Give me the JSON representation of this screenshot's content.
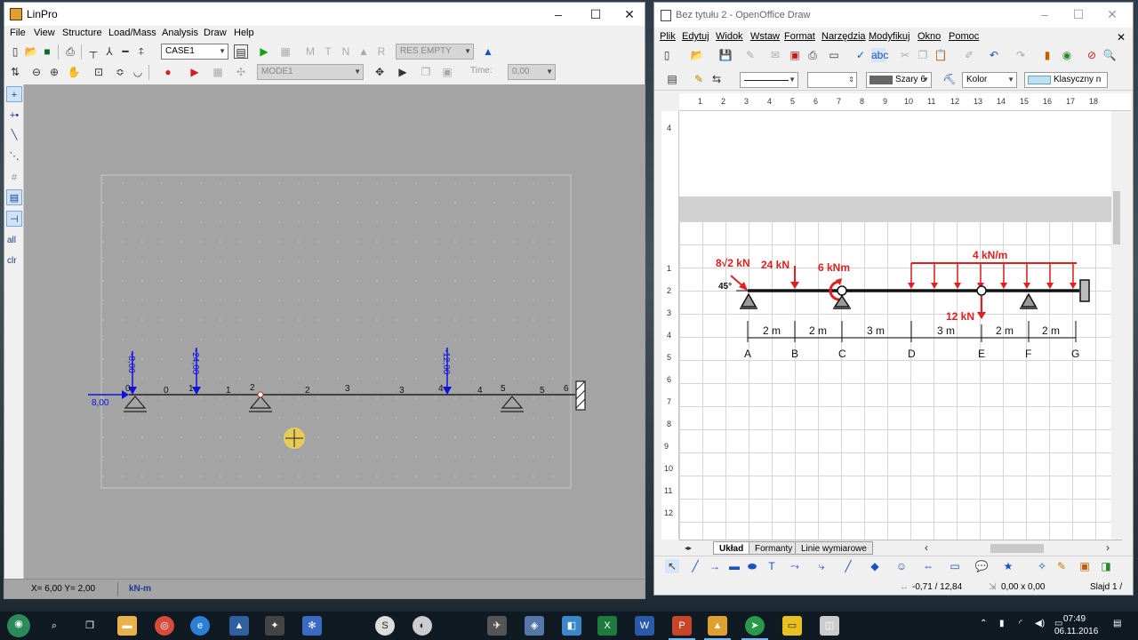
{
  "linpro": {
    "title": "LinPro",
    "menu": [
      "File",
      "View",
      "Structure",
      "Load/Mass",
      "Analysis",
      "Draw",
      "Help"
    ],
    "case_combo": "CASE1",
    "results_combo": "RES EMPTY",
    "mode_combo": "MODE1",
    "time_label": "Time:",
    "time_value": "0,00",
    "left_toolbar": {
      "all": "all",
      "clr": "clr"
    },
    "status": {
      "coords": "X= 6,00  Y= 2,00",
      "units": "kN-m"
    },
    "model": {
      "horizontal_load": "8,00",
      "point_loads": [
        "-8,00",
        "-24,00",
        "-12,00"
      ],
      "node_labels": [
        "0",
        "1",
        "2",
        "3",
        "4",
        "5",
        "6"
      ],
      "element_labels": [
        "0",
        "1",
        "2",
        "3",
        "4",
        "5"
      ]
    }
  },
  "draw": {
    "title": "Bez tytułu 2 - OpenOffice Draw",
    "menu": [
      "Plik",
      "Edytuj",
      "Widok",
      "Wstaw",
      "Format",
      "Narzędzia",
      "Modyfikuj",
      "Okno",
      "Pomoc"
    ],
    "area_color": "Szary 6",
    "color_mode": "Kolor",
    "style_combo": "Klasyczny n",
    "tabs": [
      "Układ",
      "Formanty",
      "Linie wymiarowe"
    ],
    "status": {
      "position": "-0,71 / 12,84",
      "size": "0,00 x 0,00",
      "slide": "Slajd 1 /"
    },
    "ruler_h": [
      "1",
      "2",
      "3",
      "4",
      "5",
      "6",
      "7",
      "8",
      "9",
      "10",
      "11",
      "12",
      "13",
      "14",
      "15",
      "16",
      "17",
      "18"
    ],
    "ruler_v": [
      "4",
      "1",
      "2",
      "3",
      "4",
      "5",
      "6",
      "7",
      "8",
      "9",
      "10",
      "11",
      "12"
    ],
    "sketch": {
      "load_incline": "8√2 kN",
      "angle": "45°",
      "load_24": "24 kN",
      "moment": "6 kNm",
      "distributed": "4 kN/m",
      "load_12": "12 kN",
      "dimensions": [
        "2 m",
        "2 m",
        "3 m",
        "3 m",
        "2 m",
        "2 m"
      ],
      "points": [
        "A",
        "B",
        "C",
        "D",
        "E",
        "F",
        "G"
      ]
    }
  },
  "taskbar": {
    "time": "07:49",
    "date": "06.11.2016"
  },
  "colors": {
    "load_blue": "#1010e0",
    "load_red": "#e02020",
    "canvas_grey": "#a4a4a4"
  }
}
